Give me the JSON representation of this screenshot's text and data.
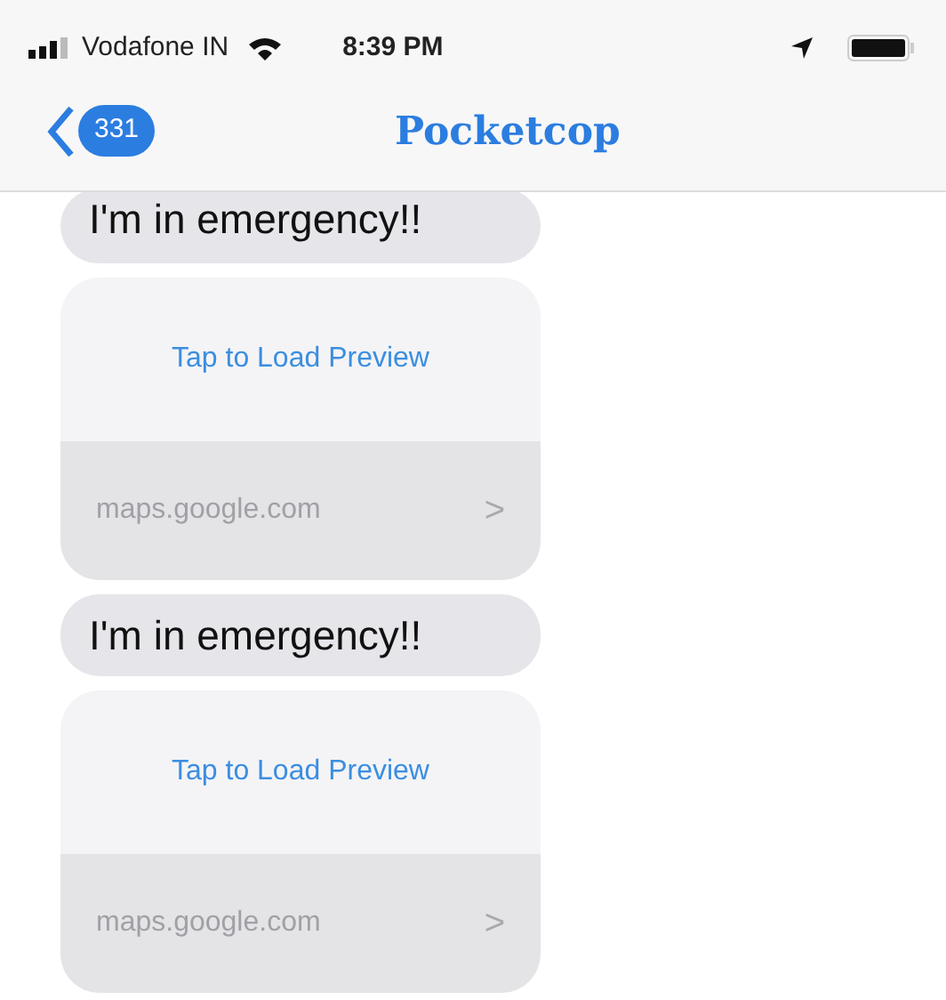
{
  "status_bar": {
    "carrier": "Vodafone IN",
    "time": "8:39 PM"
  },
  "nav": {
    "back_count": "331",
    "title": "Pocketcop"
  },
  "messages": [
    {
      "kind": "text",
      "text": "I'm in emergency!!"
    },
    {
      "kind": "link_preview",
      "action": "Tap to Load Preview",
      "domain": "maps.google.com",
      "chevron": ">"
    },
    {
      "kind": "text",
      "text": "I'm in emergency!!"
    },
    {
      "kind": "link_preview",
      "action": "Tap to Load Preview",
      "domain": "maps.google.com",
      "chevron": ">"
    }
  ]
}
